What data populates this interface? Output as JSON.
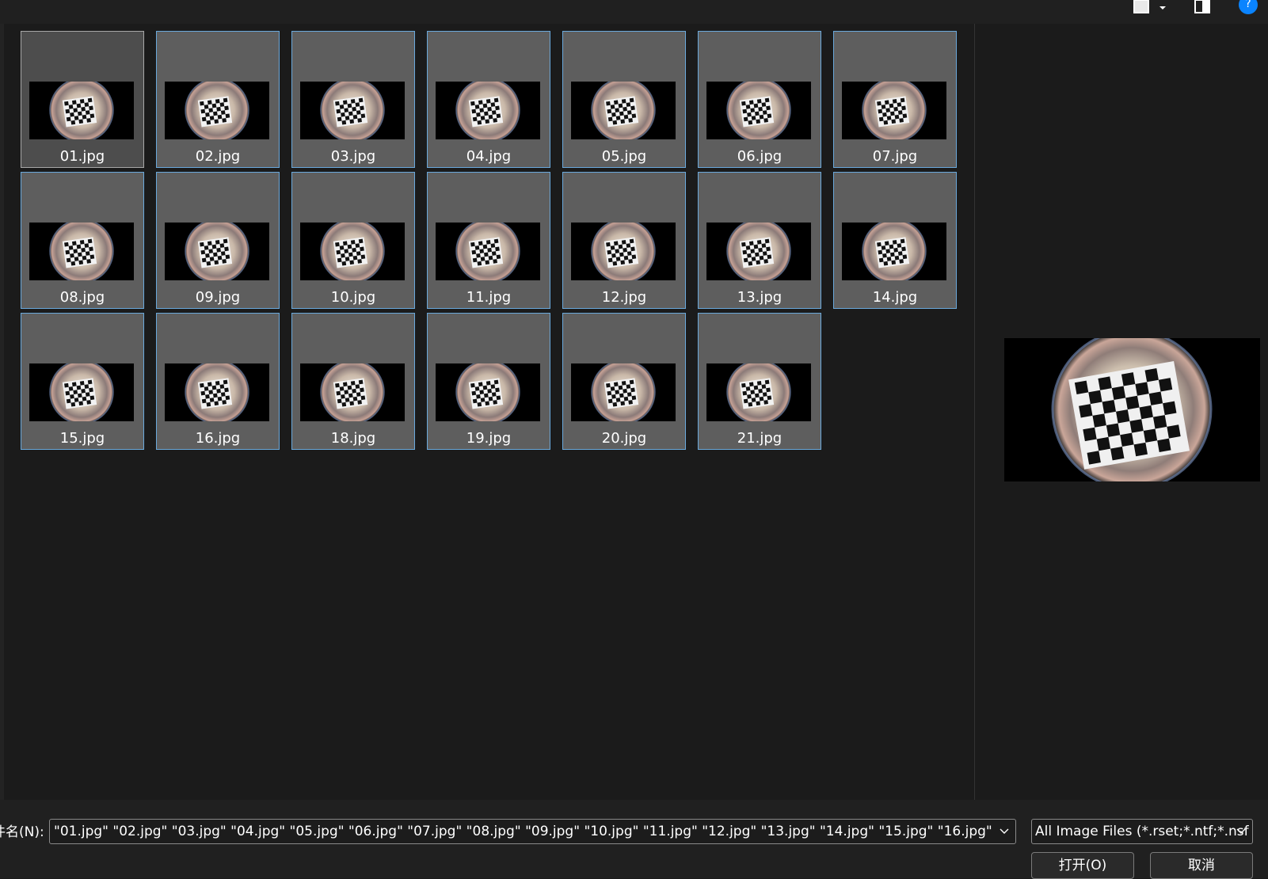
{
  "toolbar": {
    "view_icon": "view-mode-icon",
    "view_dropdown_icon": "chevron-down-icon",
    "preview_pane_icon": "preview-pane-icon",
    "help_icon": "help-icon",
    "help_label": "?"
  },
  "files": [
    {
      "name": "01.jpg"
    },
    {
      "name": "02.jpg"
    },
    {
      "name": "03.jpg"
    },
    {
      "name": "04.jpg"
    },
    {
      "name": "05.jpg"
    },
    {
      "name": "06.jpg"
    },
    {
      "name": "07.jpg"
    },
    {
      "name": "08.jpg"
    },
    {
      "name": "09.jpg"
    },
    {
      "name": "10.jpg"
    },
    {
      "name": "11.jpg"
    },
    {
      "name": "12.jpg"
    },
    {
      "name": "13.jpg"
    },
    {
      "name": "14.jpg"
    },
    {
      "name": "15.jpg"
    },
    {
      "name": "16.jpg"
    },
    {
      "name": "18.jpg"
    },
    {
      "name": "19.jpg"
    },
    {
      "name": "20.jpg"
    },
    {
      "name": "21.jpg"
    }
  ],
  "footer": {
    "filename_label": "件名(N):",
    "filename_value": "\"01.jpg\" \"02.jpg\" \"03.jpg\" \"04.jpg\" \"05.jpg\" \"06.jpg\" \"07.jpg\" \"08.jpg\" \"09.jpg\" \"10.jpg\" \"11.jpg\" \"12.jpg\" \"13.jpg\" \"14.jpg\" \"15.jpg\" \"16.jpg\"",
    "filetype_value": "All Image Files (*.rset;*.ntf;*.nsf",
    "open_label": "打开(O)",
    "cancel_label": "取消"
  },
  "colors": {
    "selection_border": "#6aa9dc",
    "tile_bg": "#5e5e5e",
    "accent": "#0a84ff"
  }
}
